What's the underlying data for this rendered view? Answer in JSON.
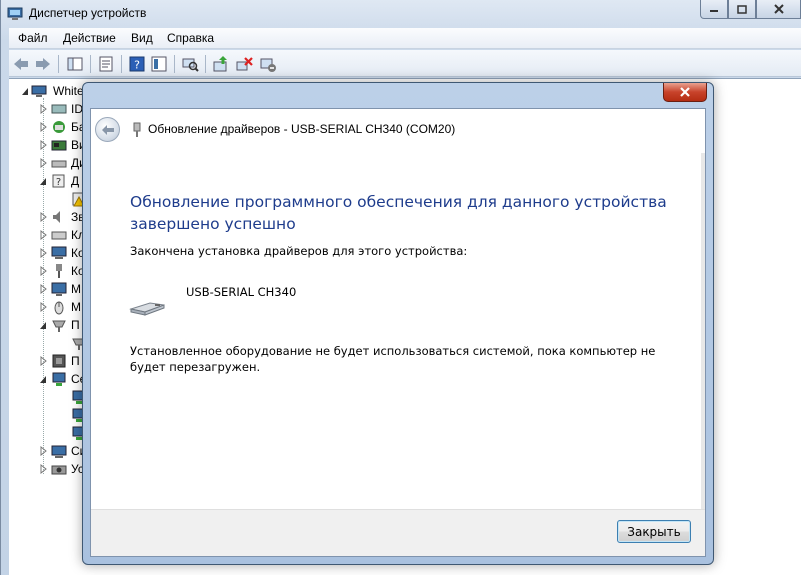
{
  "main_window": {
    "title": "Диспетчер устройств",
    "menu": [
      "Файл",
      "Действие",
      "Вид",
      "Справка"
    ],
    "tree": {
      "root_label": "White",
      "items": [
        {
          "label": "ID",
          "expanded": false
        },
        {
          "label": "Ба",
          "expanded": false
        },
        {
          "label": "Ви",
          "expanded": false
        },
        {
          "label": "Ди",
          "expanded": false
        },
        {
          "label": "Д",
          "expanded": true
        },
        {
          "label": "",
          "expanded": null
        },
        {
          "label": "Зв",
          "expanded": false
        },
        {
          "label": "Кл",
          "expanded": false
        },
        {
          "label": "Ко",
          "expanded": false
        },
        {
          "label": "Ко",
          "expanded": false
        },
        {
          "label": "М",
          "expanded": false
        },
        {
          "label": "М",
          "expanded": false
        },
        {
          "label": "П",
          "expanded": true
        },
        {
          "label": "",
          "expanded": null
        },
        {
          "label": "П",
          "expanded": false
        },
        {
          "label": "Се",
          "expanded": true
        },
        {
          "label": "",
          "expanded": null
        },
        {
          "label": "",
          "expanded": null
        },
        {
          "label": "",
          "expanded": null
        },
        {
          "label": "Си",
          "expanded": false
        },
        {
          "label": "Ус",
          "expanded": false
        }
      ]
    }
  },
  "dialog": {
    "header_title": "Обновление драйверов - USB-SERIAL CH340 (COM20)",
    "heading": "Обновление программного обеспечения для данного устройства завершено успешно",
    "install_done": "Закончена установка драйверов для этого устройства:",
    "device_name": "USB-SERIAL CH340",
    "reboot_note": "Установленное оборудование не будет использоваться системой, пока компьютер не будет перезагружен.",
    "close_button": "Закрыть"
  }
}
